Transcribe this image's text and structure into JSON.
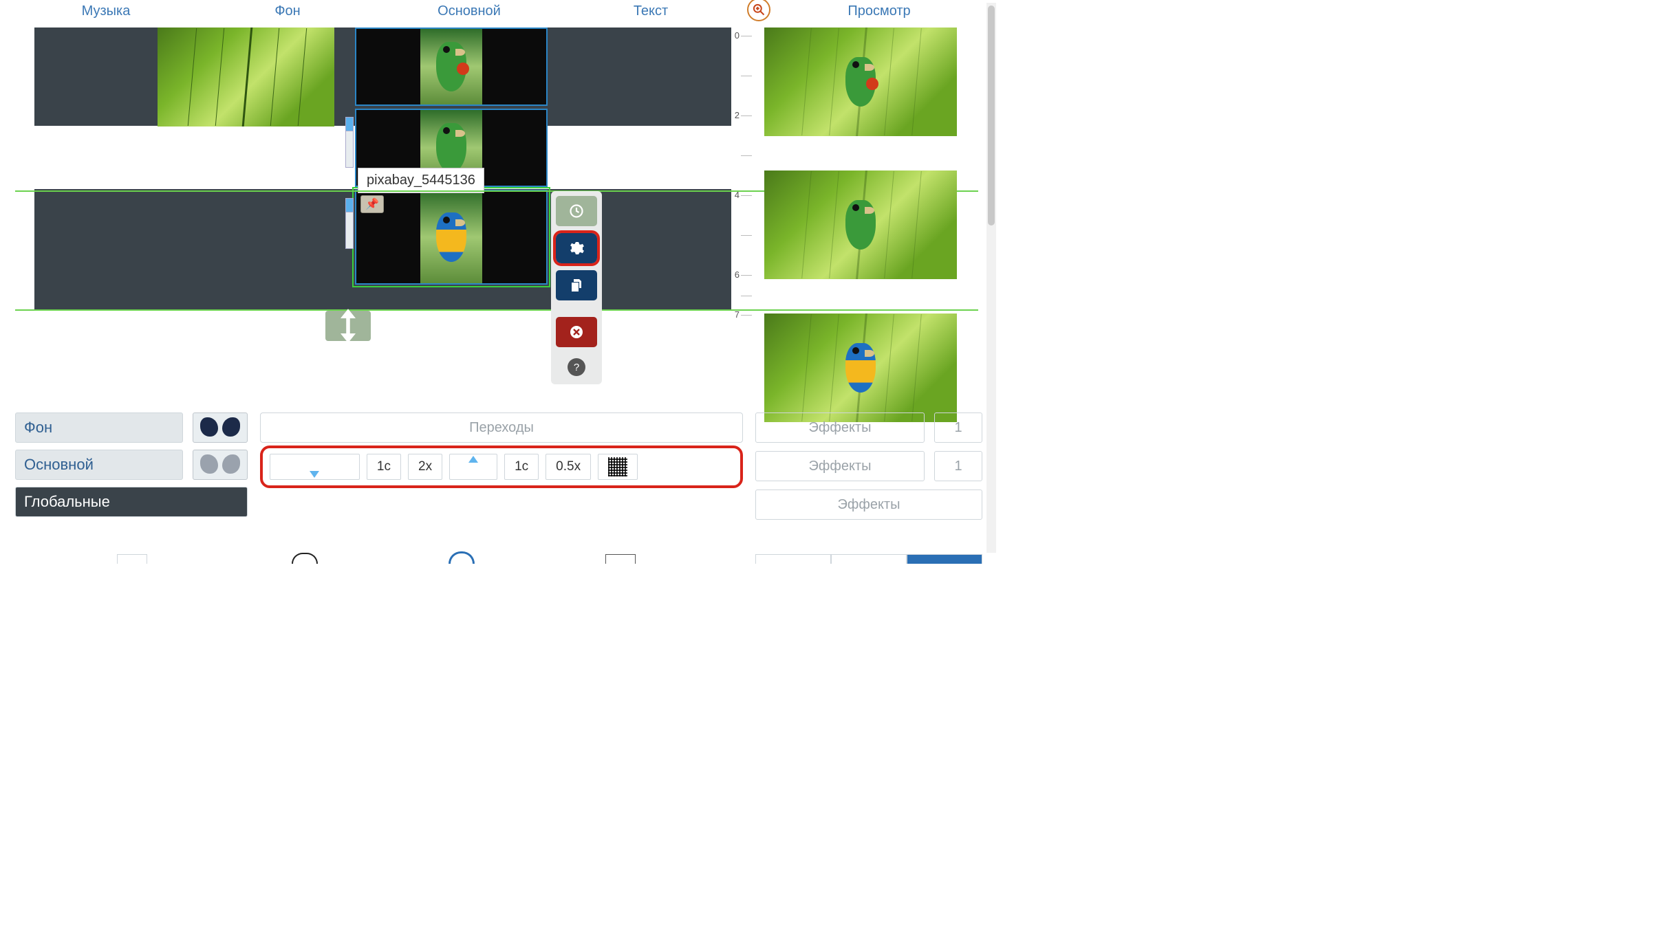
{
  "tabs": {
    "music": "Музыка",
    "background": "Фон",
    "main": "Основной",
    "text": "Текст",
    "preview": "Просмотр"
  },
  "ruler_ticks": [
    "0",
    "2",
    "4",
    "6",
    "7"
  ],
  "tooltip": "pixabay_5445136",
  "actions": {
    "time": "time",
    "settings": "settings",
    "copy": "copy",
    "delete": "delete",
    "help": "?"
  },
  "layers": {
    "background": "Фон",
    "main": "Основной",
    "global": "Глобальные"
  },
  "transitions_label": "Переходы",
  "speed": {
    "in_box": "",
    "sec_in": "1с",
    "x2": "2x",
    "out_box": "",
    "sec_out": "1с",
    "x05": "0.5x"
  },
  "effects": {
    "label": "Эффекты",
    "count1": "1",
    "count2": "1"
  }
}
